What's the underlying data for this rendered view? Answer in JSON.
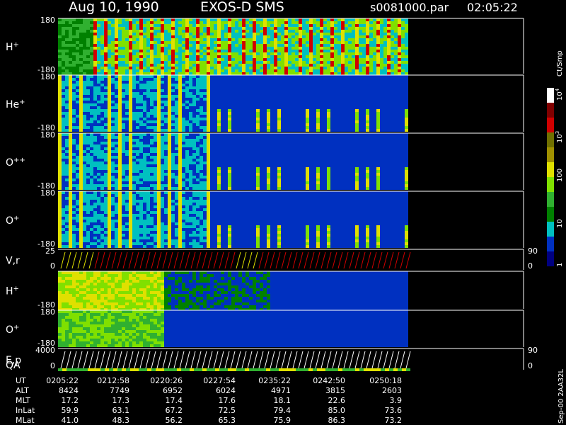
{
  "header": {
    "date": "Aug 10, 1990",
    "instrument": "EXOS-D SMS",
    "file": "s0081000.par",
    "time": "02:05:22"
  },
  "chart_data": {
    "type": "heatmap",
    "title": "",
    "panels": [
      {
        "label": "H",
        "sup": "+",
        "ymax": "180",
        "ymin": "-180"
      },
      {
        "label": "He",
        "sup": "+",
        "ymax": "180",
        "ymin": "-180"
      },
      {
        "label": "O",
        "sup": "++",
        "ymax": "180",
        "ymin": "-180"
      },
      {
        "label": "O",
        "sup": "+",
        "ymax": "180",
        "ymin": "-180"
      },
      {
        "label": "V,r",
        "sup": "",
        "ymax": "25",
        "ymin": "0",
        "right_top": "90",
        "right_bot": "0"
      },
      {
        "label": "H",
        "sup": "+",
        "ymax": "",
        "ymin": "-180"
      },
      {
        "label": "O",
        "sup": "+",
        "ymax": "180",
        "ymin": "-180"
      },
      {
        "label": "E,p",
        "sup": "",
        "ymax": "4000",
        "ymin": "0",
        "right_top": "90",
        "right_bot": "0",
        "label2": "QA"
      }
    ],
    "colorbar": {
      "label": "Ct/Smp",
      "ticks": [
        {
          "base": "10",
          "exp": "4"
        },
        {
          "base": "10",
          "exp": "3"
        },
        {
          "base": "100",
          "exp": ""
        },
        {
          "base": "10",
          "exp": ""
        },
        {
          "base": "1",
          "exp": ""
        }
      ],
      "colors": [
        "#000080",
        "#0030c0",
        "#00c0c0",
        "#008000",
        "#30b030",
        "#80e000",
        "#e0e000",
        "#a09000",
        "#707000",
        "#d00000",
        "#800000",
        "#ffffff"
      ]
    },
    "orbit_table": {
      "rows": [
        {
          "label": "UT",
          "values": [
            "0205:22",
            "0212:58",
            "0220:26",
            "0227:54",
            "0235:22",
            "0242:50",
            "0250:18"
          ]
        },
        {
          "label": "ALT",
          "values": [
            "8424",
            "7749",
            "6952",
            "6024",
            "4971",
            "3815",
            "2603"
          ]
        },
        {
          "label": "MLT",
          "values": [
            "17.2",
            "17.3",
            "17.4",
            "17.6",
            "18.1",
            "22.6",
            "3.9"
          ]
        },
        {
          "label": "InLat",
          "values": [
            "59.9",
            "63.1",
            "67.2",
            "72.5",
            "79.4",
            "85.0",
            "73.6"
          ]
        },
        {
          "label": "MLat",
          "values": [
            "41.0",
            "48.3",
            "56.2",
            "65.3",
            "75.9",
            "86.3",
            "73.2"
          ]
        }
      ]
    },
    "side_label": "Sep-00  2AA32L"
  }
}
